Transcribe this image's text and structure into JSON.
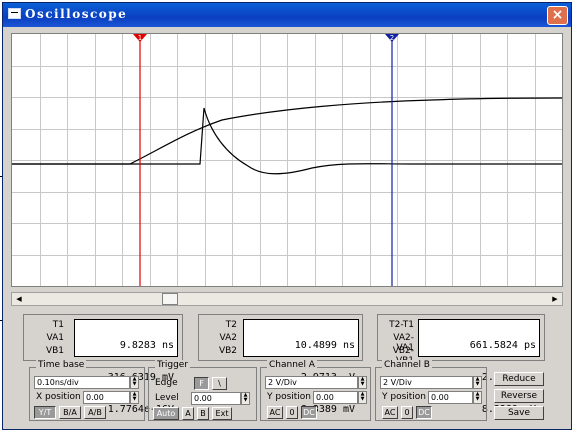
{
  "window": {
    "title": "Oscilloscope",
    "close_label": "×"
  },
  "cursors": {
    "t1_label": "1",
    "t2_label": "2",
    "t1_color": "#e00000",
    "t2_color": "#1020a0"
  },
  "trace_color": "#000000",
  "grid_color": "#c8c8c8",
  "readouts": {
    "col1": {
      "rows": [
        {
          "label": "T1",
          "value": "9.8283 ns"
        },
        {
          "label": "VA1",
          "value": "316.6319 mV"
        },
        {
          "label": "VB1",
          "value": "1.7764e-16V"
        }
      ]
    },
    "col2": {
      "rows": [
        {
          "label": "T2",
          "value": "10.4899 ns"
        },
        {
          "label": "VA2",
          "value": "2.9713  V"
        },
        {
          "label": "VB2",
          "value": "8.3389 mV"
        }
      ]
    },
    "col3": {
      "rows": [
        {
          "label": "T2-T1",
          "value": "661.5824 ps"
        },
        {
          "label": "VA2-VA1",
          "value": "2.6546  V"
        },
        {
          "label": "VB2-VB1",
          "value": "8.3389 mV"
        }
      ]
    }
  },
  "timebase": {
    "title": "Time base",
    "scale": "0.10ns/div",
    "xpos_label": "X position",
    "xpos": "0.00",
    "mode_yt": "Y/T",
    "mode_ba": "B/A",
    "mode_ab": "A/B"
  },
  "trigger": {
    "title": "Trigger",
    "edge_label": "Edge",
    "edge_rise": "F",
    "edge_fall": "\\",
    "level_label": "Level",
    "level": "0.00",
    "auto": "Auto",
    "a": "A",
    "b": "B",
    "ext": "Ext"
  },
  "channel_a": {
    "title": "Channel A",
    "scale": "2 V/Div",
    "ypos_label": "Y position",
    "ypos": "0.00",
    "ac": "AC",
    "zero": "0",
    "dc": "DC"
  },
  "channel_b": {
    "title": "Channel B",
    "scale": "2 V/Div",
    "ypos_label": "Y position",
    "ypos": "0.00",
    "ac": "AC",
    "zero": "0",
    "dc": "DC"
  },
  "actions": {
    "reduce": "Reduce",
    "reverse": "Reverse",
    "save": "Save"
  },
  "scrollbar": {
    "left_arrow": "◀",
    "right_arrow": "▶"
  }
}
